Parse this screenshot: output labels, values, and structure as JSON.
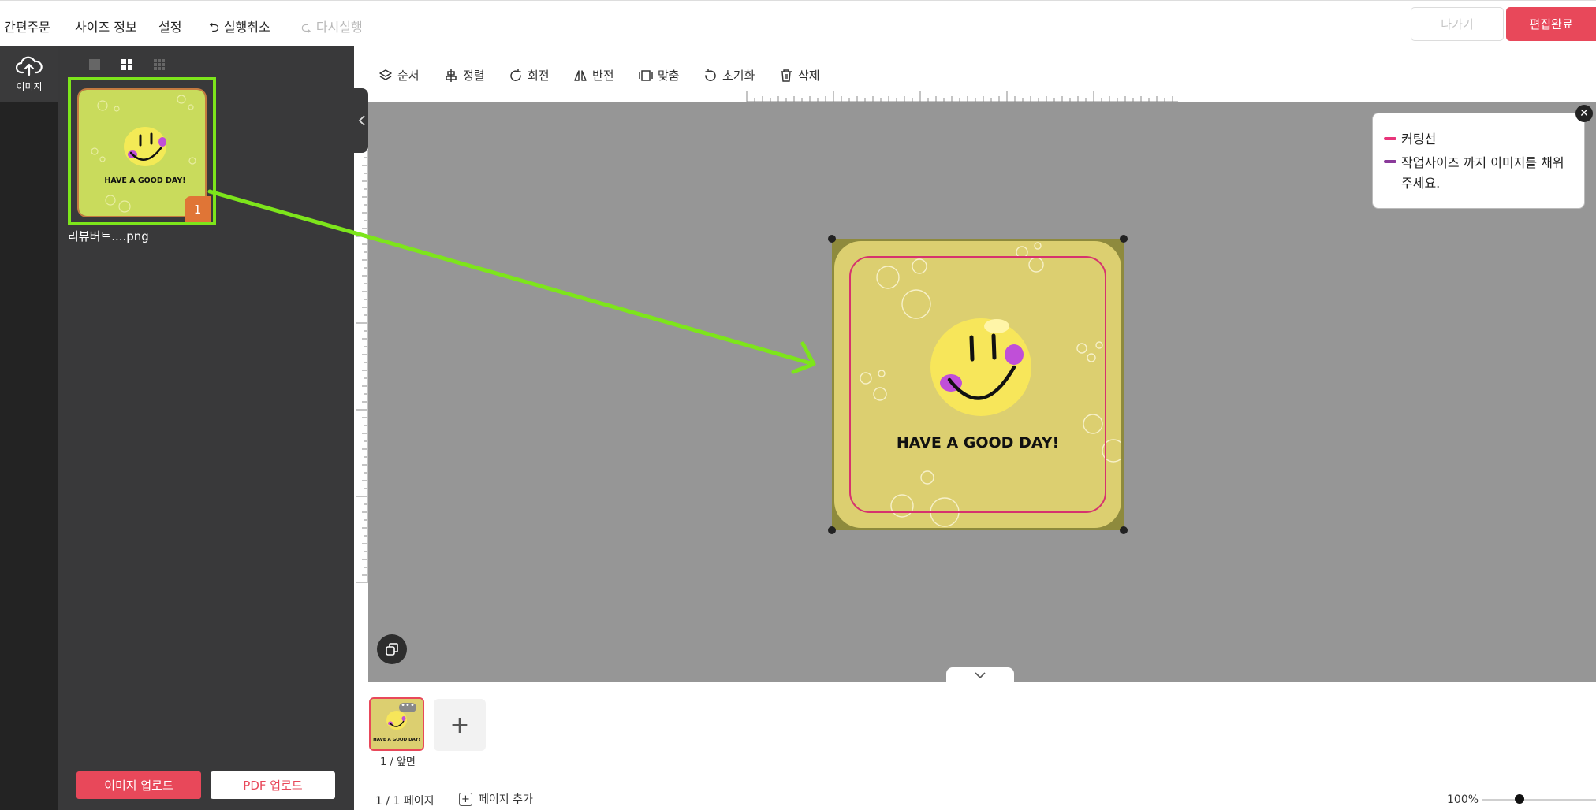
{
  "topbar": {
    "quick_order": "간편주문",
    "size_info": "사이즈 정보",
    "settings": "설정",
    "undo": "실행취소",
    "redo": "다시실행",
    "exit": "나가기",
    "done": "편집완료"
  },
  "rail": {
    "upload_label": "이미지"
  },
  "panel": {
    "view_modes": [
      "single-view",
      "grid-2-view",
      "grid-3-view"
    ],
    "thumbnail": {
      "name": "리뷰버트....png",
      "badge": "1"
    },
    "image_upload": "이미지 업로드",
    "pdf_upload": "PDF 업로드"
  },
  "toolbar": {
    "order": "순서",
    "align": "정렬",
    "rotate": "회전",
    "flip": "반전",
    "fit": "맞춤",
    "reset": "초기화",
    "delete": "삭제"
  },
  "artboard": {
    "text": "HAVE A GOOD DAY!",
    "colors": {
      "background": "#dccf70",
      "bleed": "#8e8a3d",
      "cutline": "#d6336e"
    }
  },
  "legend": {
    "items": [
      {
        "label": "커팅선",
        "color": "#e8357a"
      },
      {
        "label": "작업사이즈 까지 이미지를 채워 주세요.",
        "color": "#8a3a9a"
      }
    ]
  },
  "pages": {
    "thumb_label": "1 / 앞면",
    "more": "•••",
    "add": "+"
  },
  "status": {
    "page_count": "1 / 1 페이지",
    "add_page": "페이지 추가",
    "zoom": "100%"
  },
  "colors": {
    "accent": "#e8485a",
    "highlight": "#7de51b",
    "badge": "#e07536"
  }
}
